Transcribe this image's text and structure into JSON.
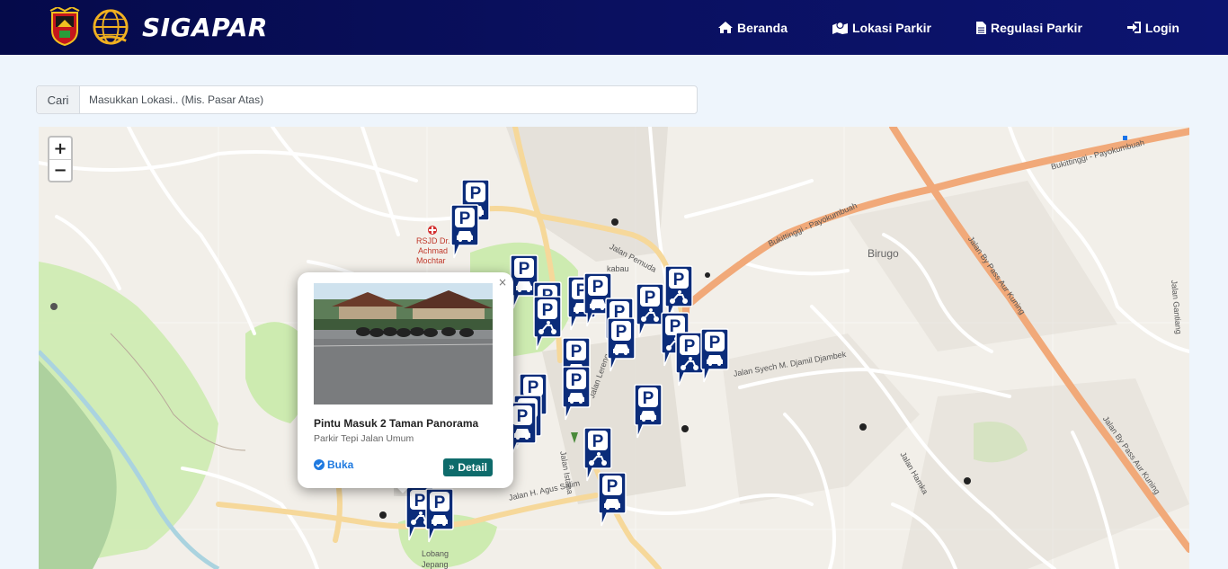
{
  "brand": {
    "name": "SIGAPAR"
  },
  "nav": {
    "items": [
      {
        "label": "Beranda",
        "icon": "home-icon"
      },
      {
        "label": "Lokasi Parkir",
        "icon": "map-icon"
      },
      {
        "label": "Regulasi Parkir",
        "icon": "file-icon"
      },
      {
        "label": "Login",
        "icon": "sign-in-icon"
      }
    ]
  },
  "search": {
    "label": "Cari",
    "placeholder": "Masukkan Lokasi.. (Mis. Pasar Atas)"
  },
  "map": {
    "zoom_in": "+",
    "zoom_out": "−",
    "labels": {
      "rsud": "RSJD Dr.",
      "achmad": "Achmad",
      "mochtar": "Mochtar",
      "jalan_pemuda": "Jalan Pemuda",
      "bukittinggi_payo_1": "Bukittinggi - Payokumbuah",
      "bukittinggi_payo_2": "Bukittinggi - Payokumbuah",
      "birugo": "Birugo",
      "syech": "Jalan Syech M. Djamil Djambek",
      "bypass": "Jalan By Pass Aur Kuning",
      "agus_salim": "Jalan H. Agus Salim",
      "istana": "Jalan Istana",
      "hamka": "Jalan Hamka",
      "lobang": "Lobang",
      "jepang": "Jepang",
      "gantiang": "Jalan Gantiang",
      "lereng": "Jalan Lereng",
      "kabau": "kabau"
    }
  },
  "popup": {
    "title": "Pintu Masuk 2 Taman Panorama",
    "subtitle": "Parkir Tepi Jalan Umum",
    "status": "Buka",
    "detail_label": "Detail",
    "close": "×"
  },
  "colors": {
    "navbar": "#0a1060",
    "marker": "#0b2c7a",
    "detail_button": "#0e6b6b",
    "status": "#1f7ae0"
  }
}
